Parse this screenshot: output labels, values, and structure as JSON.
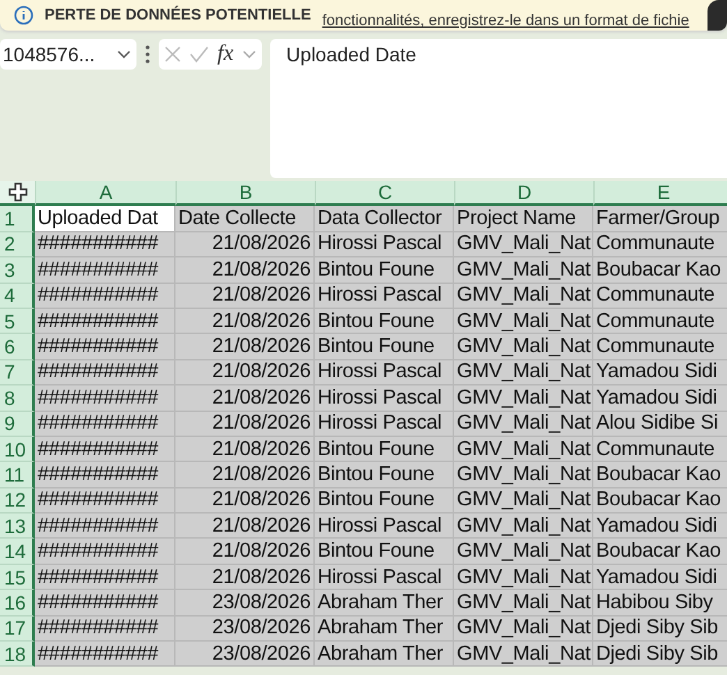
{
  "banner": {
    "title": "PERTE DE DONNÉES POTENTIELLE",
    "message": "fonctionnalités, enregistrez-le dans un format de fichie"
  },
  "formula_bar": {
    "name_box": "1048576...",
    "function_label": "fx",
    "formula": "Uploaded Date"
  },
  "columns": [
    {
      "label": "A",
      "selected": true
    },
    {
      "label": "B",
      "selected": true
    },
    {
      "label": "C",
      "selected": true
    },
    {
      "label": "D",
      "selected": true
    },
    {
      "label": "E",
      "selected": true
    }
  ],
  "rows": [
    {
      "number": "1",
      "selected": true,
      "active": true,
      "cells": [
        "Uploaded Dat",
        "Date Collecte",
        "Data Collector",
        "Project Name",
        "Farmer/Group"
      ]
    },
    {
      "number": "2",
      "selected": true,
      "active": false,
      "cells": [
        "###########",
        "21/08/2026",
        "Hirossi Pascal",
        "GMV_Mali_Nat",
        "Communaute"
      ]
    },
    {
      "number": "3",
      "selected": true,
      "active": false,
      "cells": [
        "###########",
        "21/08/2026",
        "Bintou Foune",
        "GMV_Mali_Nat",
        "Boubacar Kao"
      ]
    },
    {
      "number": "4",
      "selected": true,
      "active": false,
      "cells": [
        "###########",
        "21/08/2026",
        "Hirossi Pascal",
        "GMV_Mali_Nat",
        "Communaute"
      ]
    },
    {
      "number": "5",
      "selected": true,
      "active": false,
      "cells": [
        "###########",
        "21/08/2026",
        "Bintou Foune",
        "GMV_Mali_Nat",
        "Communaute"
      ]
    },
    {
      "number": "6",
      "selected": true,
      "active": false,
      "cells": [
        "###########",
        "21/08/2026",
        "Bintou Foune",
        "GMV_Mali_Nat",
        "Communaute"
      ]
    },
    {
      "number": "7",
      "selected": true,
      "active": false,
      "cells": [
        "###########",
        "21/08/2026",
        "Hirossi Pascal",
        "GMV_Mali_Nat",
        "Yamadou Sidi"
      ]
    },
    {
      "number": "8",
      "selected": true,
      "active": false,
      "cells": [
        "###########",
        "21/08/2026",
        "Hirossi Pascal",
        "GMV_Mali_Nat",
        "Yamadou Sidi"
      ]
    },
    {
      "number": "9",
      "selected": true,
      "active": false,
      "cells": [
        "###########",
        "21/08/2026",
        "Hirossi Pascal",
        "GMV_Mali_Nat",
        "Alou Sidibe Si"
      ]
    },
    {
      "number": "10",
      "selected": true,
      "active": false,
      "cells": [
        "###########",
        "21/08/2026",
        "Bintou Foune",
        "GMV_Mali_Nat",
        "Communaute"
      ]
    },
    {
      "number": "11",
      "selected": true,
      "active": false,
      "cells": [
        "###########",
        "21/08/2026",
        "Bintou Foune",
        "GMV_Mali_Nat",
        "Boubacar Kao"
      ]
    },
    {
      "number": "12",
      "selected": true,
      "active": false,
      "cells": [
        "###########",
        "21/08/2026",
        "Bintou Foune",
        "GMV_Mali_Nat",
        "Boubacar Kao"
      ]
    },
    {
      "number": "13",
      "selected": true,
      "active": false,
      "cells": [
        "###########",
        "21/08/2026",
        "Hirossi Pascal",
        "GMV_Mali_Nat",
        "Yamadou Sidi"
      ]
    },
    {
      "number": "14",
      "selected": true,
      "active": false,
      "cells": [
        "###########",
        "21/08/2026",
        "Bintou Foune",
        "GMV_Mali_Nat",
        "Boubacar Kao"
      ]
    },
    {
      "number": "15",
      "selected": true,
      "active": false,
      "cells": [
        "###########",
        "21/08/2026",
        "Hirossi Pascal",
        "GMV_Mali_Nat",
        "Yamadou Sidi"
      ]
    },
    {
      "number": "16",
      "selected": true,
      "active": false,
      "cells": [
        "###########",
        "23/08/2026",
        "Abraham Ther",
        "GMV_Mali_Nat",
        "Habibou Siby"
      ]
    },
    {
      "number": "17",
      "selected": true,
      "active": false,
      "cells": [
        "###########",
        "23/08/2026",
        "Abraham Ther",
        "GMV_Mali_Nat",
        "Djedi Siby Sib"
      ]
    },
    {
      "number": "18",
      "selected": true,
      "active": false,
      "cells": [
        "###########",
        "23/08/2026",
        "Abraham Ther",
        "GMV_Mali_Nat",
        "Djedi Siby Sib"
      ]
    }
  ]
}
